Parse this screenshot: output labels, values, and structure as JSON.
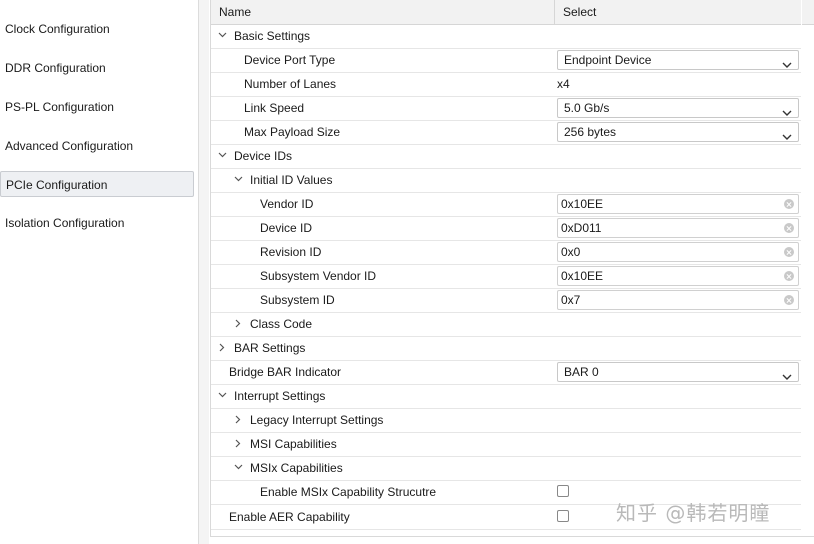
{
  "nav": {
    "items": [
      {
        "label": "Clock Configuration"
      },
      {
        "label": "DDR Configuration"
      },
      {
        "label": "PS-PL Configuration"
      },
      {
        "label": "Advanced Configuration"
      },
      {
        "label": "PCIe Configuration"
      },
      {
        "label": "Isolation Configuration"
      }
    ],
    "active": "PCIe Configuration"
  },
  "table": {
    "header": {
      "name": "Name",
      "select": "Select"
    },
    "rows": [
      {
        "label": "Basic Settings",
        "expander": "expanded"
      },
      {
        "label": "Device Port Type",
        "value": "Endpoint Device",
        "control": "select"
      },
      {
        "label": "Number of Lanes",
        "value": "x4",
        "control": "text"
      },
      {
        "label": "Link Speed",
        "value": "5.0 Gb/s",
        "control": "select"
      },
      {
        "label": "Max Payload Size",
        "value": "256 bytes",
        "control": "select"
      },
      {
        "label": "Device IDs",
        "expander": "expanded"
      },
      {
        "label": "Initial ID Values",
        "expander": "expanded"
      },
      {
        "label": "Vendor ID",
        "value": "0x10EE",
        "control": "input"
      },
      {
        "label": "Device ID",
        "value": "0xD011",
        "control": "input"
      },
      {
        "label": "Revision ID",
        "value": "0x0",
        "control": "input"
      },
      {
        "label": "Subsystem Vendor ID",
        "value": "0x10EE",
        "control": "input"
      },
      {
        "label": "Subsystem ID",
        "value": "0x7",
        "control": "input"
      },
      {
        "label": "Class Code",
        "expander": "collapsed"
      },
      {
        "label": "BAR Settings",
        "expander": "collapsed"
      },
      {
        "label": "Bridge BAR Indicator",
        "value": "BAR 0",
        "control": "select"
      },
      {
        "label": "Interrupt Settings",
        "expander": "expanded"
      },
      {
        "label": "Legacy Interrupt Settings",
        "expander": "collapsed"
      },
      {
        "label": "MSI Capabilities",
        "expander": "collapsed"
      },
      {
        "label": "MSIx Capabilities",
        "expander": "expanded"
      },
      {
        "label": "Enable MSIx Capability Strucutre",
        "checked": false,
        "control": "checkbox"
      },
      {
        "label": "Enable AER Capability",
        "checked": false,
        "control": "checkbox"
      }
    ]
  },
  "watermark": "知乎 @韩若明瞳"
}
